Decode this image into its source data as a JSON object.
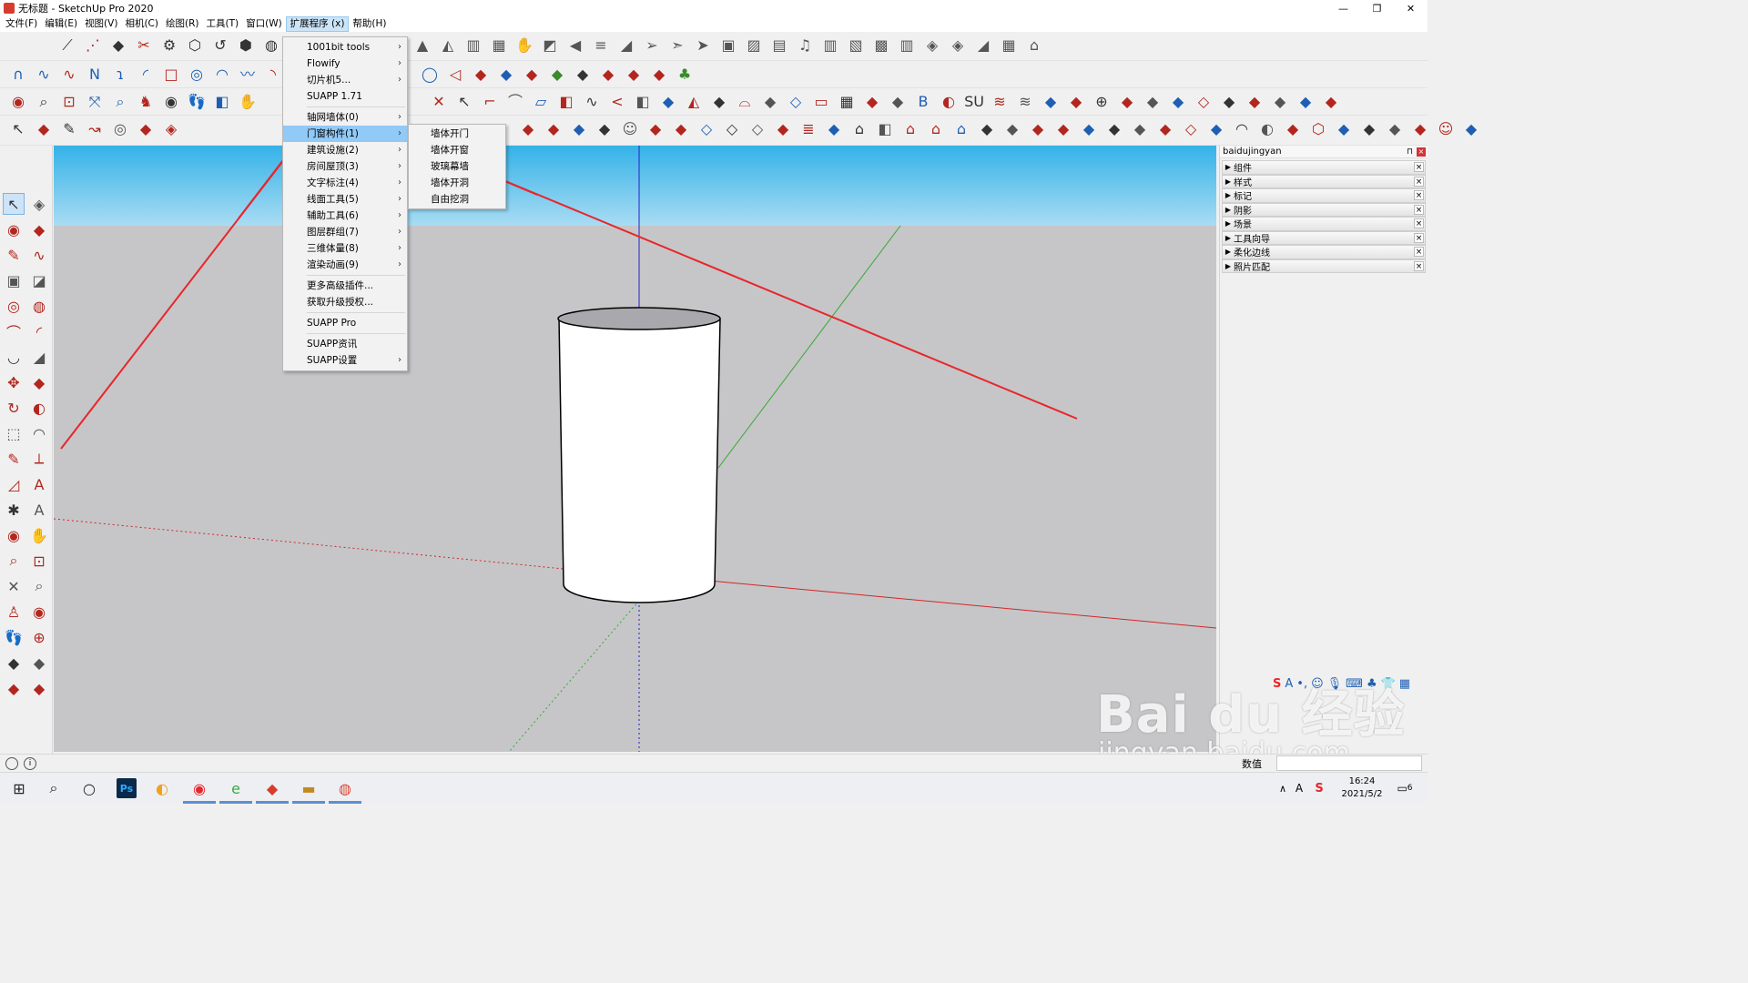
{
  "window": {
    "title": "无标题 - SketchUp Pro 2020",
    "minimize": "—",
    "restore": "❐",
    "close": "✕"
  },
  "menubar": {
    "items": [
      "文件(F)",
      "编辑(E)",
      "视图(V)",
      "相机(C)",
      "绘图(R)",
      "工具(T)",
      "窗口(W)",
      "扩展程序 (x)",
      "帮助(H)"
    ],
    "active_index": 7
  },
  "extensions_menu": {
    "items": [
      {
        "label": "1001bit tools",
        "submenu": true
      },
      {
        "label": "Flowify",
        "submenu": true
      },
      {
        "label": "切片机5...",
        "submenu": true
      },
      {
        "label": "SUAPP 1.71",
        "submenu": false
      },
      {
        "sep": true
      },
      {
        "label": "轴网墙体(0)",
        "submenu": true
      },
      {
        "label": "门窗构件(1)",
        "submenu": true,
        "highlight": true
      },
      {
        "label": "建筑设施(2)",
        "submenu": true
      },
      {
        "label": "房间屋顶(3)",
        "submenu": true
      },
      {
        "label": "文字标注(4)",
        "submenu": true
      },
      {
        "label": "线面工具(5)",
        "submenu": true
      },
      {
        "label": "辅助工具(6)",
        "submenu": true
      },
      {
        "label": "图层群组(7)",
        "submenu": true
      },
      {
        "label": "三维体量(8)",
        "submenu": true
      },
      {
        "label": "渲染动画(9)",
        "submenu": true
      },
      {
        "sep": true
      },
      {
        "label": "更多高级插件...",
        "submenu": false
      },
      {
        "label": "获取升级授权...",
        "submenu": false
      },
      {
        "sep": true
      },
      {
        "label": "SUAPP Pro",
        "submenu": false
      },
      {
        "sep": true
      },
      {
        "label": "SUAPP资讯",
        "submenu": false
      },
      {
        "label": "SUAPP设置",
        "submenu": true
      }
    ]
  },
  "door_window_submenu": {
    "items": [
      "墙体开门",
      "墙体开窗",
      "玻璃幕墙",
      "墙体开洞",
      "自由挖洞"
    ],
    "target_index": 2
  },
  "tray": {
    "title": "baidujingyan",
    "pin": "⊓",
    "close": "×",
    "panels": [
      "组件",
      "样式",
      "标记",
      "阴影",
      "场景",
      "工具向导",
      "柔化边线",
      "照片匹配"
    ]
  },
  "statusbar": {
    "measure_label": "数值",
    "info_icon": "i"
  },
  "taskbar": {
    "time": "16:24",
    "date": "2021/5/2",
    "notification_count": "6"
  },
  "ime": {
    "logo": "S"
  },
  "watermark": {
    "main": "Bai du 经验",
    "sub": "jingyan.baidu.com"
  },
  "colors": {
    "sky_top": "#34b2e8",
    "ground": "#c6c6c8",
    "axis_red": "#d42626",
    "axis_green": "#38a838",
    "axis_blue": "#2222cc",
    "annotation_arrow": "#e8262c",
    "menu_highlight": "#91c9f7"
  },
  "icons": {
    "toolbar_row1": [
      "line-icon",
      "freehand-icon",
      "push-icon",
      "eraser-icon",
      "gear-icon",
      "follow-icon",
      "offset-icon",
      "cube-icon",
      "globe-icon"
    ],
    "toolbar_row1_right": [
      "ruler-icon",
      "prism-icon",
      "stairs-icon",
      "grid-icon",
      "hand-icon",
      "leaf-icon",
      "plane-icon",
      "bars-icon",
      "slope-icon",
      "arrow-icon",
      "arrow2-icon",
      "arrow3-icon",
      "building-icon",
      "stripes-icon",
      "box-icon",
      "note-icon",
      "wall-icon",
      "diagonal-icon",
      "stripes2-icon",
      "columns-icon",
      "stack-icon",
      "stack2-icon",
      "slope2-icon",
      "ruler2-icon",
      "house-icon"
    ],
    "left_toolbar": [
      "select-icon",
      "component-icon",
      "paint-icon",
      "eraser-icon",
      "pencil-icon",
      "freehand-icon",
      "rectangle-icon",
      "rotated-rect-icon",
      "circle-icon",
      "polygon-icon",
      "arc-icon",
      "pie-icon",
      "arc2-icon",
      "arc3-icon",
      "move-icon",
      "pushpull-icon",
      "rotate-icon",
      "followme-icon",
      "scale-icon",
      "offset-icon",
      "tape-icon",
      "dimension-icon",
      "protractor-icon",
      "text-icon",
      "axes-icon",
      "3dtext-icon",
      "orbit-icon",
      "pan-icon",
      "zoom-icon",
      "zoomwindow-icon",
      "zoomextents-icon",
      "previous-icon",
      "position-icon",
      "lookaround-icon",
      "walk-icon",
      "section-icon",
      "warehouse-icon",
      "extension-icon",
      "share-icon",
      "ruby-icon"
    ]
  }
}
